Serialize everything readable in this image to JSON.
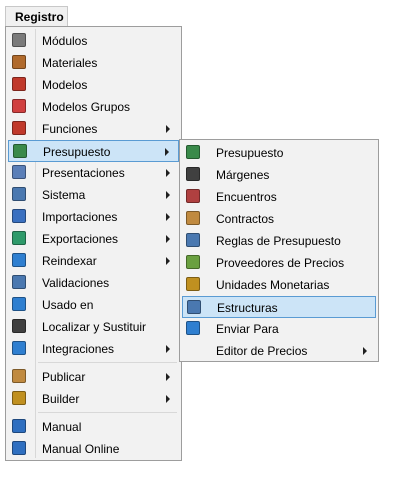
{
  "menubar": {
    "title": "Registro"
  },
  "main_menu": {
    "items": [
      {
        "label": "Módulos",
        "icon": "modules-icon",
        "color": "#7a7a7a",
        "has_submenu": false
      },
      {
        "label": "Materiales",
        "icon": "materials-icon",
        "color": "#b06a2c",
        "has_submenu": false
      },
      {
        "label": "Modelos",
        "icon": "models-icon",
        "color": "#c0392b",
        "has_submenu": false
      },
      {
        "label": "Modelos Grupos",
        "icon": "model-groups-icon",
        "color": "#d04040",
        "has_submenu": false
      },
      {
        "label": "Funciones",
        "icon": "functions-icon",
        "color": "#c0392b",
        "has_submenu": true
      },
      {
        "label": "Presupuesto",
        "icon": "budget-icon",
        "color": "#3a8a4a",
        "has_submenu": true,
        "highlighted": true
      },
      {
        "label": "Presentaciones",
        "icon": "presentations-icon",
        "color": "#5b7fb8",
        "has_submenu": true
      },
      {
        "label": "Sistema",
        "icon": "system-gear-icon",
        "color": "#4a78b0",
        "has_submenu": true
      },
      {
        "label": "Importaciones",
        "icon": "import-icon",
        "color": "#3a70c0",
        "has_submenu": true
      },
      {
        "label": "Exportaciones",
        "icon": "export-icon",
        "color": "#2e9a6a",
        "has_submenu": true
      },
      {
        "label": "Reindexar",
        "icon": "reindex-icon",
        "color": "#2f7fd0",
        "has_submenu": true
      },
      {
        "label": "Validaciones",
        "icon": "validation-icon",
        "color": "#4a78b0",
        "has_submenu": false
      },
      {
        "label": "Usado en",
        "icon": "used-in-icon",
        "color": "#2f7fd0",
        "has_submenu": false
      },
      {
        "label": "Localizar y Sustituir",
        "icon": "find-replace-icon",
        "color": "#404040",
        "has_submenu": false
      },
      {
        "label": "Integraciones",
        "icon": "integrations-icon",
        "color": "#2f7fd0",
        "has_submenu": true
      },
      {
        "label": "Publicar",
        "icon": "publish-icon",
        "color": "#c08a40",
        "has_submenu": true
      },
      {
        "label": "Builder",
        "icon": "builder-icon",
        "color": "#c09020",
        "has_submenu": true
      },
      {
        "label": "Manual",
        "icon": "manual-book-icon",
        "color": "#2f6fc0",
        "has_submenu": false
      },
      {
        "label": "Manual Online",
        "icon": "help-online-icon",
        "color": "#2f6fc0",
        "has_submenu": false
      }
    ]
  },
  "submenu": {
    "items": [
      {
        "label": "Presupuesto",
        "icon": "budget-icon",
        "color": "#3a8a4a",
        "has_submenu": false
      },
      {
        "label": "Márgenes",
        "icon": "margins-icon",
        "color": "#404040",
        "has_submenu": false
      },
      {
        "label": "Encuentros",
        "icon": "junctions-icon",
        "color": "#b04040",
        "has_submenu": false
      },
      {
        "label": "Contractos",
        "icon": "contracts-icon",
        "color": "#c08a40",
        "has_submenu": false
      },
      {
        "label": "Reglas de Presupuesto",
        "icon": "budget-rules-icon",
        "color": "#4a78b0",
        "has_submenu": false
      },
      {
        "label": "Proveedores de Precios",
        "icon": "price-providers-icon",
        "color": "#6aa040",
        "has_submenu": false
      },
      {
        "label": "Unidades Monetarias",
        "icon": "currency-units-icon",
        "color": "#c09020",
        "has_submenu": false
      },
      {
        "label": "Estructuras",
        "icon": "structures-icon",
        "color": "#4a78b0",
        "has_submenu": false,
        "highlighted": true
      },
      {
        "label": "Enviar Para",
        "icon": "send-to-icon",
        "color": "#2f7fd0",
        "has_submenu": false
      },
      {
        "label": "Editor de Precios",
        "icon": "",
        "color": "",
        "has_submenu": true
      }
    ]
  }
}
